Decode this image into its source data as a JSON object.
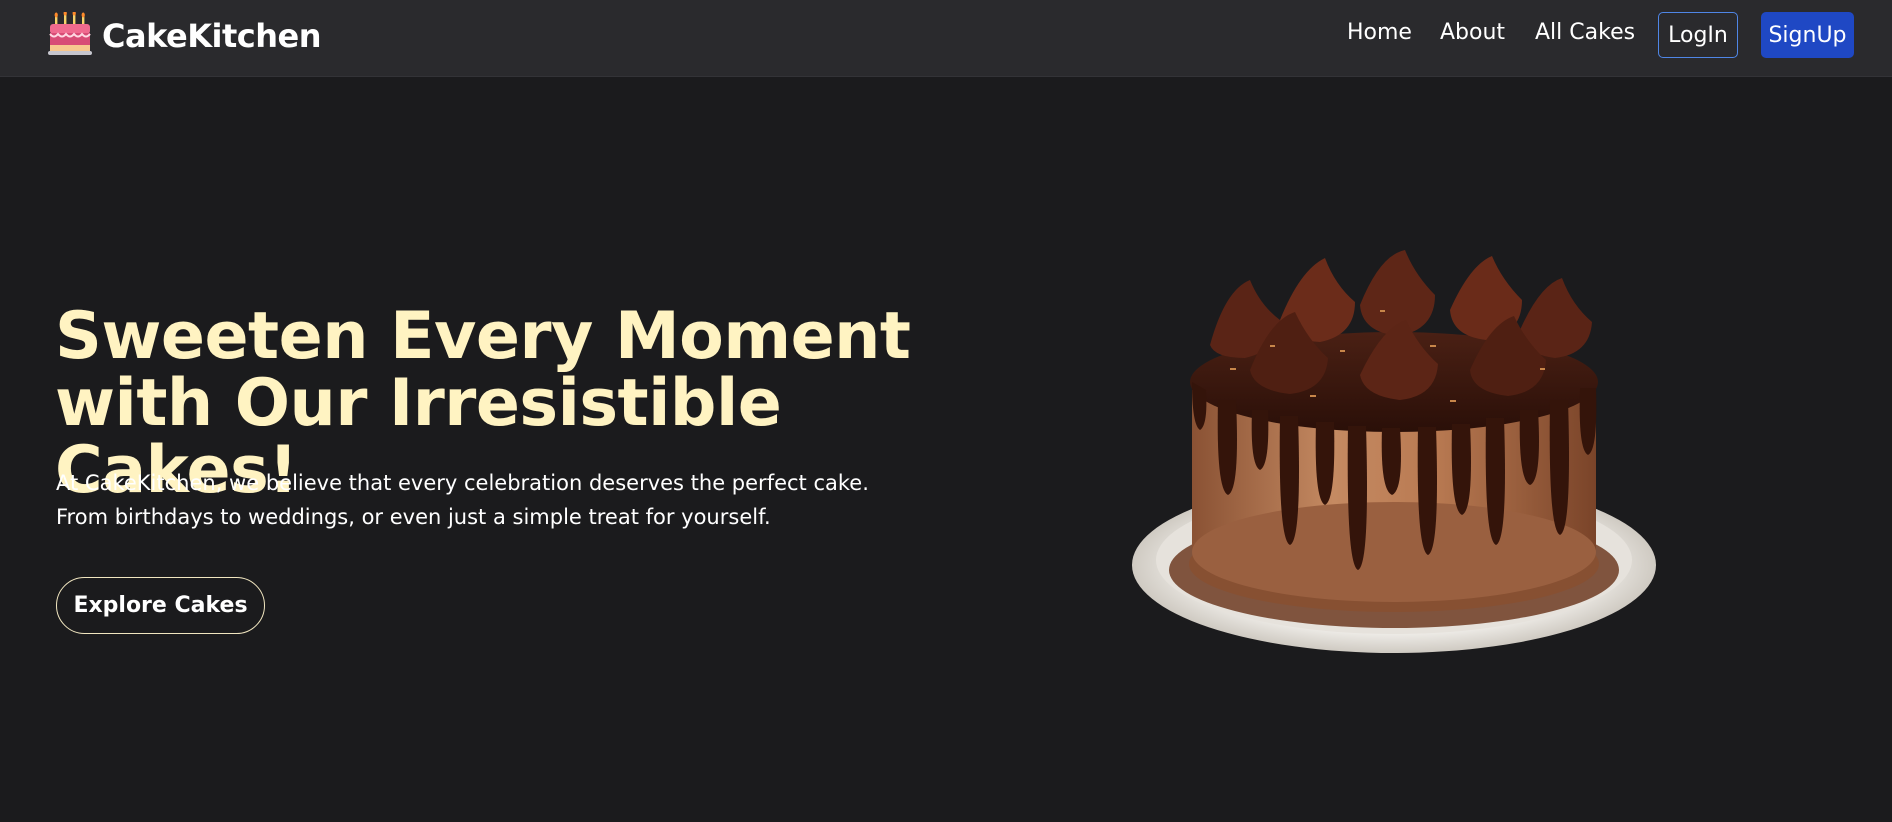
{
  "navbar": {
    "brand_name": "CakeKitchen",
    "logo_icon": "birthday-cake-icon",
    "links": [
      "Home",
      "About",
      "All Cakes"
    ],
    "login_label": "LogIn",
    "signup_label": "SignUp"
  },
  "hero": {
    "title": "Sweeten Every Moment with Our Irresistible Cakes!",
    "description": "At CakeKitchen, we believe that every celebration deserves the perfect cake. From birthdays to weddings, or even just a simple treat for yourself.",
    "cta_label": "Explore Cakes",
    "image": "chocolate-drip-cake"
  },
  "colors": {
    "background": "#1b1b1d",
    "navbar": "#2a2a2d",
    "title": "#fff3c2",
    "signup": "#1f48c4",
    "login_border": "#4f86e6"
  }
}
